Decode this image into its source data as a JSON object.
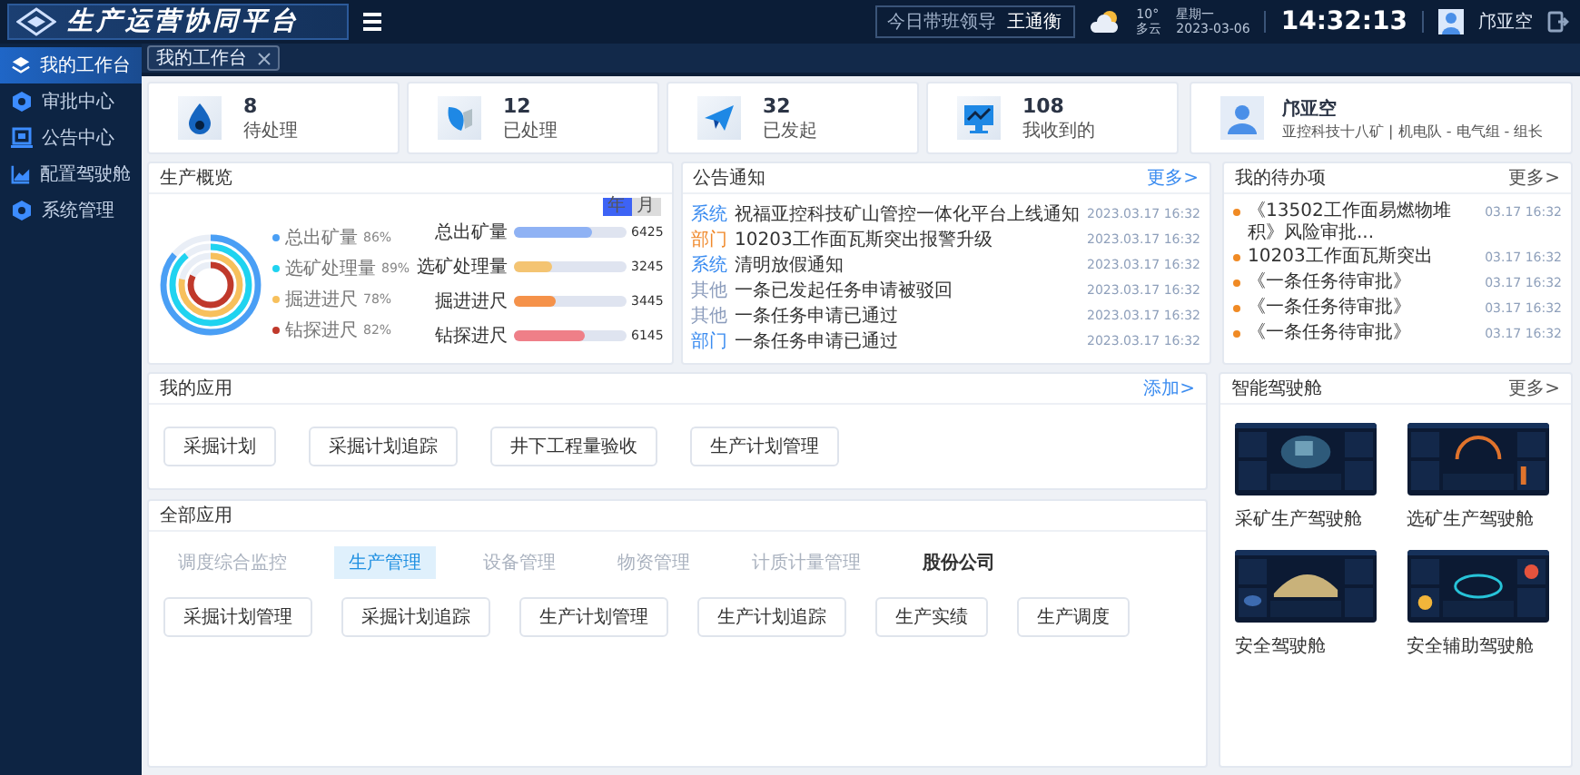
{
  "header": {
    "title": "生产运营协同平台",
    "duty_label": "今日带班领导",
    "duty_name": "王通衡",
    "temp": "10°",
    "weather": "多云",
    "weekday": "星期一",
    "date": "2023-03-06",
    "time": "14:32:13",
    "user": "邝亚空"
  },
  "sidebar": {
    "items": [
      {
        "label": "我的工作台",
        "kind": "layers",
        "selected": true
      },
      {
        "label": "审批中心",
        "kind": "hex",
        "selected": false
      },
      {
        "label": "公告中心",
        "kind": "board",
        "selected": false
      },
      {
        "label": "配置驾驶舱",
        "kind": "chart",
        "selected": false
      },
      {
        "label": "系统管理",
        "kind": "hex",
        "selected": false
      }
    ]
  },
  "tabs": [
    {
      "label": "我的工作台",
      "selected": true
    }
  ],
  "stats": [
    {
      "kind": "drop",
      "value": "8",
      "label": "待处理"
    },
    {
      "kind": "leaf",
      "value": "12",
      "label": "已处理"
    },
    {
      "kind": "plane",
      "value": "32",
      "label": "已发起"
    },
    {
      "kind": "monitor",
      "value": "108",
      "label": "我收到的"
    }
  ],
  "profile": {
    "name": "邝亚空",
    "org": "亚控科技十八矿 | 机电队 - 电气组 - 组长"
  },
  "overview": {
    "title": "生产概览",
    "periods": [
      {
        "label": "年",
        "selected": true
      },
      {
        "label": "月",
        "selected": false
      }
    ],
    "rings": [
      {
        "label": "总出矿量",
        "percent": "86%",
        "color": "#4a9ff5"
      },
      {
        "label": "选矿处理量",
        "percent": "89%",
        "color": "#1fd3f0"
      },
      {
        "label": "掘进进尺",
        "percent": "78%",
        "color": "#f7c05c"
      },
      {
        "label": "钻探进尺",
        "percent": "82%",
        "color": "#c0392b"
      }
    ],
    "bars": [
      {
        "label": "总出矿量",
        "value": "6425",
        "level": 0.7,
        "color": "#8fb2f4"
      },
      {
        "label": "选矿处理量",
        "value": "3245",
        "level": 0.35,
        "color": "#f4c472"
      },
      {
        "label": "掘进进尺",
        "value": "3445",
        "level": 0.38,
        "color": "#f5924a"
      },
      {
        "label": "钻探进尺",
        "value": "6145",
        "level": 0.63,
        "color": "#ef7f88"
      }
    ]
  },
  "notices": {
    "title": "公告通知",
    "more": "更多>",
    "items": [
      {
        "tag": "系统",
        "color": "#3b8cf0",
        "text": "祝福亚控科技矿山管控一体化平台上线通知",
        "time": "2023.03.17 16:32"
      },
      {
        "tag": "部门",
        "color": "#f0892b",
        "text": "10203工作面瓦斯突出报警升级",
        "time": "2023.03.17 16:32"
      },
      {
        "tag": "系统",
        "color": "#3b8cf0",
        "text": "清明放假通知",
        "time": "2023.03.17 16:32"
      },
      {
        "tag": "其他",
        "color": "#8a9bbb",
        "text": "一条已发起任务申请被驳回",
        "time": "2023.03.17 16:32"
      },
      {
        "tag": "其他",
        "color": "#8a9bbb",
        "text": "一条任务申请已通过",
        "time": "2023.03.17 16:32"
      },
      {
        "tag": "部门",
        "color": "#3b8cf0",
        "text": "一条任务申请已通过",
        "time": "2023.03.17 16:32"
      }
    ]
  },
  "todos": {
    "title": "我的待办项",
    "more": "更多>",
    "items": [
      {
        "text": "《13502工作面易燃物堆积》风险审批...",
        "time": "03.17 16:32"
      },
      {
        "text": "10203工作面瓦斯突出",
        "time": "03.17 16:32"
      },
      {
        "text": "《一条任务待审批》",
        "time": "03.17 16:32"
      },
      {
        "text": "《一条任务待审批》",
        "time": "03.17 16:32"
      },
      {
        "text": "《一条任务待审批》",
        "time": "03.17 16:32"
      }
    ]
  },
  "my_apps": {
    "title": "我的应用",
    "add": "添加>",
    "items": [
      "采掘计划",
      "采掘计划追踪",
      "井下工程量验收",
      "生产计划管理"
    ]
  },
  "all_apps": {
    "title": "全部应用",
    "categories": [
      {
        "label": "调度综合监控",
        "selected": false,
        "bold": false
      },
      {
        "label": "生产管理",
        "selected": true,
        "bold": false
      },
      {
        "label": "设备管理",
        "selected": false,
        "bold": false
      },
      {
        "label": "物资管理",
        "selected": false,
        "bold": false
      },
      {
        "label": "计质计量管理",
        "selected": false,
        "bold": false
      },
      {
        "label": "股份公司",
        "selected": false,
        "bold": true
      }
    ],
    "items": [
      "采掘计划管理",
      "采掘计划追踪",
      "生产计划管理",
      "生产计划追踪",
      "生产实绩",
      "生产调度"
    ]
  },
  "cockpits": {
    "title": "智能驾驶舱",
    "more": "更多>",
    "items": [
      {
        "label": "采矿生产驾驶舱"
      },
      {
        "label": "选矿生产驾驶舱"
      },
      {
        "label": "安全驾驶舱"
      },
      {
        "label": "安全辅助驾驶舱"
      }
    ]
  }
}
